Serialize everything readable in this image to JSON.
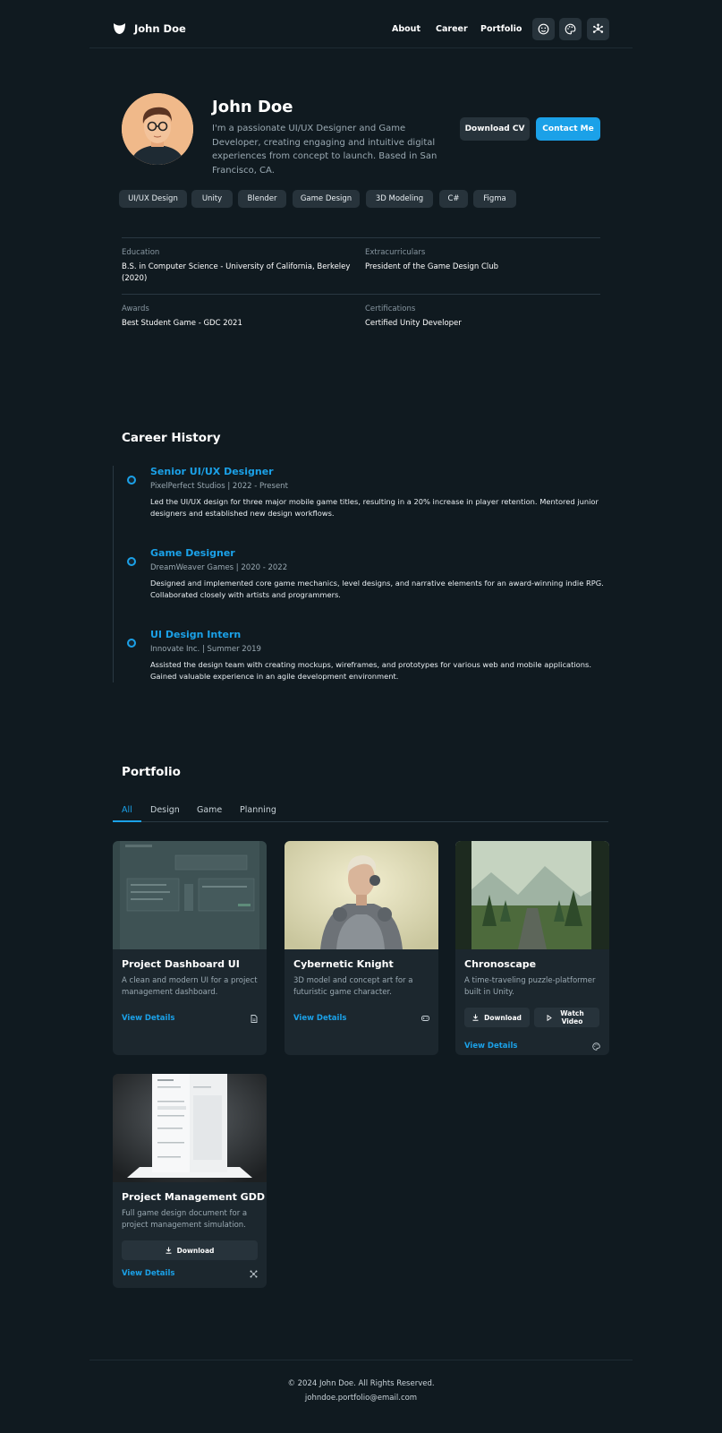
{
  "header": {
    "logo_text": "John Doe",
    "nav": [
      "About",
      "Career",
      "Portfolio"
    ],
    "icon_buttons": [
      "smiley-icon",
      "palette-icon",
      "network-icon"
    ]
  },
  "hero": {
    "name": "John Doe",
    "bio": "I'm a passionate UI/UX Designer and Game Developer, creating engaging and intuitive digital experiences from concept to launch. Based in San Francisco, CA.",
    "download_cv": "Download CV",
    "contact": "Contact Me",
    "tags": [
      "UI/UX Design",
      "Unity",
      "Blender",
      "Game Design",
      "3D Modeling",
      "C#",
      "Figma"
    ]
  },
  "info": [
    {
      "label": "Education",
      "value": "B.S. in Computer Science - University of California, Berkeley (2020)"
    },
    {
      "label": "Extracurriculars",
      "value": "President of the Game Design Club"
    },
    {
      "label": "Awards",
      "value": "Best Student Game - GDC 2021"
    },
    {
      "label": "Certifications",
      "value": "Certified Unity Developer"
    }
  ],
  "career": {
    "title": "Career History",
    "jobs": [
      {
        "title": "Senior UI/UX Designer",
        "meta": "PixelPerfect Studios | 2022 - Present",
        "desc": "Led the UI/UX design for three major mobile game titles, resulting in a 20% increase in player retention. Mentored junior designers and established new design workflows."
      },
      {
        "title": "Game Designer",
        "meta": "DreamWeaver Games | 2020 - 2022",
        "desc": "Designed and implemented core game mechanics, level designs, and narrative elements for an award-winning indie RPG. Collaborated closely with artists and programmers."
      },
      {
        "title": "UI Design Intern",
        "meta": "Innovate Inc. | Summer 2019",
        "desc": "Assisted the design team with creating mockups, wireframes, and prototypes for various web and mobile applications. Gained valuable experience in an agile development environment."
      }
    ]
  },
  "portfolio": {
    "title": "Portfolio",
    "tabs": [
      "All",
      "Design",
      "Game",
      "Planning"
    ],
    "active_tab": "All",
    "view_details": "View Details",
    "cards": [
      {
        "title": "Project Dashboard UI",
        "desc": "A clean and modern UI for a project management dashboard.",
        "type_icon": "document-icon"
      },
      {
        "title": "Cybernetic Knight",
        "desc": "3D model and concept art for a futuristic game character.",
        "type_icon": "gamepad-icon"
      },
      {
        "title": "Chronoscape",
        "desc": "A time-traveling puzzle-platformer built in Unity.",
        "type_icon": "palette-icon",
        "download": "Download",
        "watch": "Watch Video"
      },
      {
        "title": "Project Management GDD",
        "desc": "Full game design document for a project management simulation.",
        "type_icon": "network-icon",
        "download": "Download"
      }
    ]
  },
  "footer": {
    "copyright": "© 2024 John Doe. All Rights Reserved.",
    "email": "johndoe.portfolio@email.com"
  }
}
